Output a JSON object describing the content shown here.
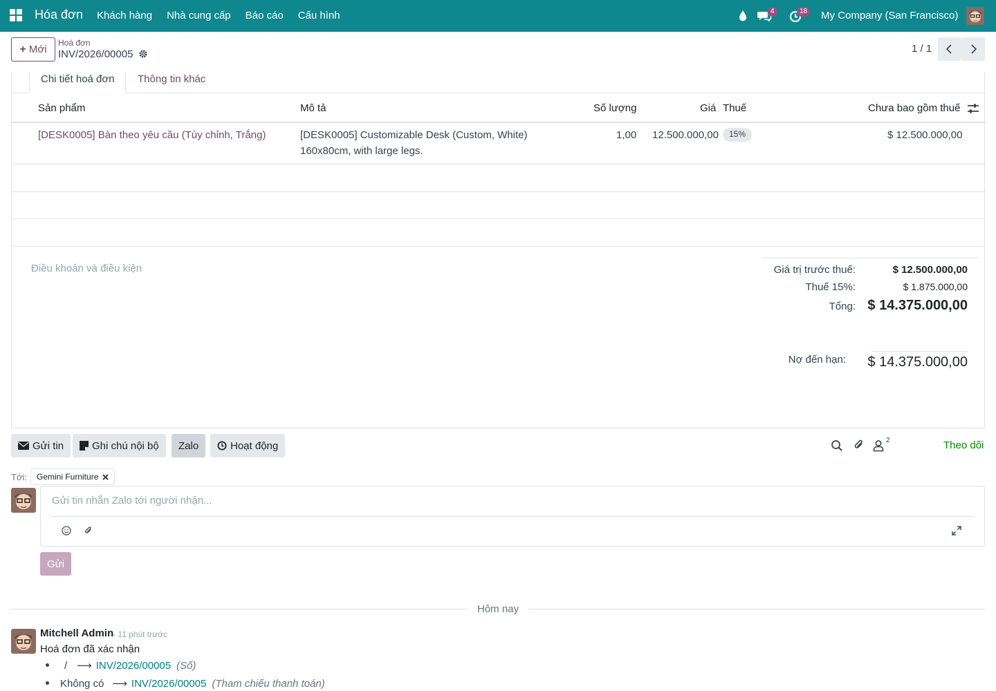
{
  "navbar": {
    "brand": "Hóa đơn",
    "menu": [
      "Khách hàng",
      "Nhà cung cấp",
      "Báo cáo",
      "Cấu hình"
    ],
    "messages_badge": "4",
    "activities_badge": "18",
    "company": "My Company (San Francisco)"
  },
  "control": {
    "new_label": "Mới",
    "breadcrumb_parent": "Hoá đơn",
    "breadcrumb_current": "INV/2026/00005",
    "pager": "1 / 1"
  },
  "tabs": [
    "Chi tiết hoá đơn",
    "Thông tin khác"
  ],
  "lines_table": {
    "headers": {
      "product": "Sản phẩm",
      "description": "Mô tả",
      "quantity": "Số lượng",
      "price": "Giá",
      "taxes": "Thuế",
      "subtotal": "Chưa bao gồm thuế"
    },
    "rows": [
      {
        "product": "[DESK0005] Bàn theo yêu cầu (Tùy chỉnh, Trắng)",
        "description_line1": "[DESK0005] Customizable Desk (Custom, White)",
        "description_line2": "160x80cm, with large legs.",
        "quantity": "1,00",
        "price": "12.500.000,00",
        "tax": "15%",
        "subtotal": "$ 12.500.000,00"
      }
    ]
  },
  "terms_placeholder": "Điều khoản và điều kiện",
  "totals": {
    "untaxed_label": "Giá trị trước thuế:",
    "untaxed_value": "$ 12.500.000,00",
    "tax_label": "Thuế 15%:",
    "tax_value": "$ 1.875.000,00",
    "total_label": "Tổng:",
    "total_value": "$ 14.375.000,00",
    "due_label": "Nợ đến hạn:",
    "due_value": "$ 14.375.000,00"
  },
  "chatter": {
    "send_message": "Gửi tin",
    "log_note": "Ghi chú nội bộ",
    "zalo": "Zalo",
    "activity": "Hoạt động",
    "followers_count": "2",
    "follow": "Theo dõi",
    "to_label": "Tới:",
    "recipient": "Gemini Furniture",
    "composer_placeholder": "Gửi tin nhắn Zalo tới người nhận...",
    "send": "Gửi",
    "date_separator": "Hôm nay",
    "message": {
      "author": "Mitchell Admin",
      "time": "- 11 phút trước",
      "body": "Hoá đơn đã xác nhận",
      "changes": [
        {
          "old": "/",
          "new": "INV/2026/00005",
          "field": "(Số)"
        },
        {
          "old": "Không có",
          "new": "INV/2026/00005",
          "field": "(Tham chiếu thanh toán)"
        }
      ]
    }
  },
  "colors": {
    "navbar": "#0f878e",
    "primary": "#714b67",
    "link": "#017e84",
    "follow": "#008a00"
  }
}
